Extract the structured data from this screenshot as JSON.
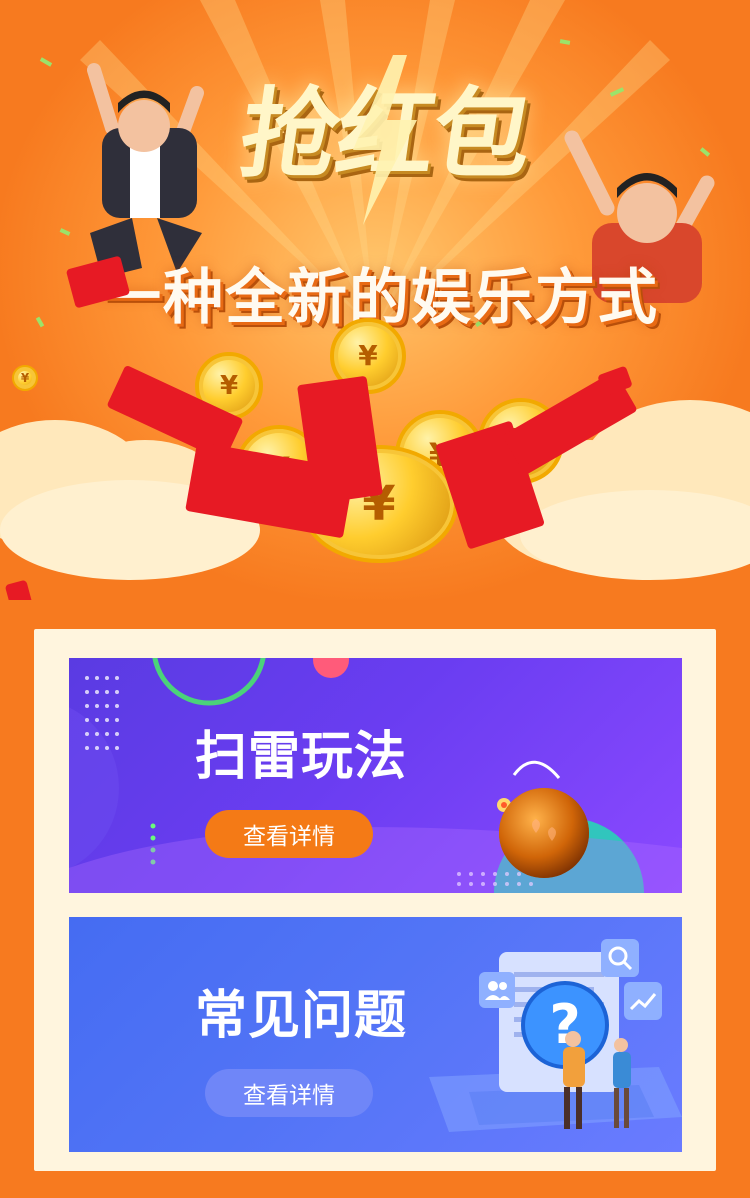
{
  "hero": {
    "title": "抢红包",
    "subtitle": "一种全新的娱乐方式"
  },
  "cards": [
    {
      "title": "扫雷玩法",
      "button_label": "查看详情"
    },
    {
      "title": "常见问题",
      "button_label": "查看详情"
    }
  ],
  "colors": {
    "page_background": "#f77a1f",
    "panel_background": "#fff5de",
    "card1_gradient": [
      "#5a3be2",
      "#8b49ff"
    ],
    "card2_gradient": [
      "#456cf2",
      "#6a7bff"
    ],
    "orange_button": "#f47a16",
    "blue_button": "#6f86f8"
  },
  "icons": {
    "bomb": "bomb-icon",
    "question": "question-icon",
    "search": "search-icon",
    "chart": "chart-icon",
    "users": "users-icon"
  }
}
